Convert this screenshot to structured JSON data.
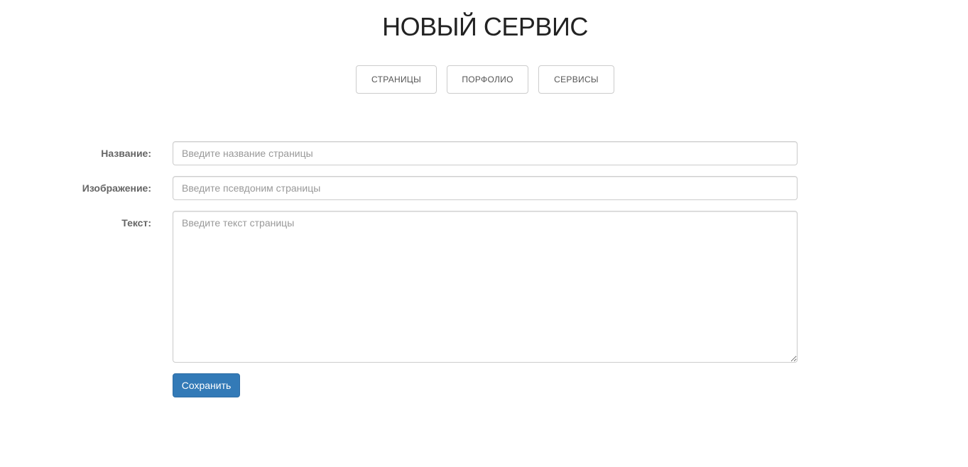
{
  "page": {
    "title": "НОВЫЙ СЕРВИС"
  },
  "nav": {
    "items": [
      {
        "label": "СТРАНИЦЫ"
      },
      {
        "label": "ПОРФОЛИО"
      },
      {
        "label": "СЕРВИСЫ"
      }
    ]
  },
  "form": {
    "name": {
      "label": "Название:",
      "value": "",
      "placeholder": "Введите название страницы"
    },
    "image": {
      "label": "Изображение:",
      "value": "",
      "placeholder": "Введите псевдоним страницы"
    },
    "text": {
      "label": "Текст:",
      "value": "",
      "placeholder": "Введите текст страницы"
    },
    "submit_label": "Сохранить"
  },
  "colors": {
    "primary": "#337ab7",
    "title": "#222222",
    "label": "#666666",
    "border": "#cccccc"
  }
}
